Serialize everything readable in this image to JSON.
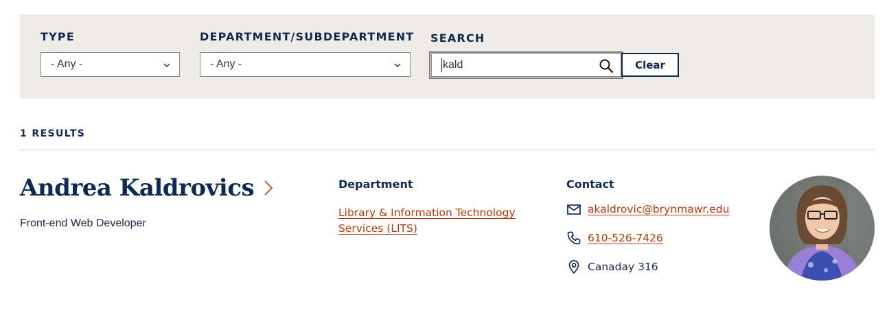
{
  "filters": {
    "type": {
      "label": "Type",
      "value": "- Any -"
    },
    "department": {
      "label": "Department/Subdepartment",
      "value": "- Any -"
    },
    "search": {
      "label": "Search",
      "value": "kald"
    },
    "clear_label": "Clear"
  },
  "results": {
    "count_text": "1 RESULTS",
    "items": [
      {
        "name": "Andrea Kaldrovics",
        "title": "Front-end Web Developer",
        "department_heading": "Department",
        "department": "Library & Information Technology Services (LITS)",
        "contact_heading": "Contact",
        "email": "akaldrovic@brynmawr.edu",
        "phone": "610-526-7426",
        "office": "Canaday 316"
      }
    ]
  },
  "colors": {
    "navy": "#0e2a52",
    "link": "#b23a0f",
    "filter_bg": "#efece8"
  },
  "icons": [
    "chevron-down-icon",
    "search-icon",
    "chevron-right-icon",
    "mail-icon",
    "phone-icon",
    "location-pin-icon"
  ]
}
